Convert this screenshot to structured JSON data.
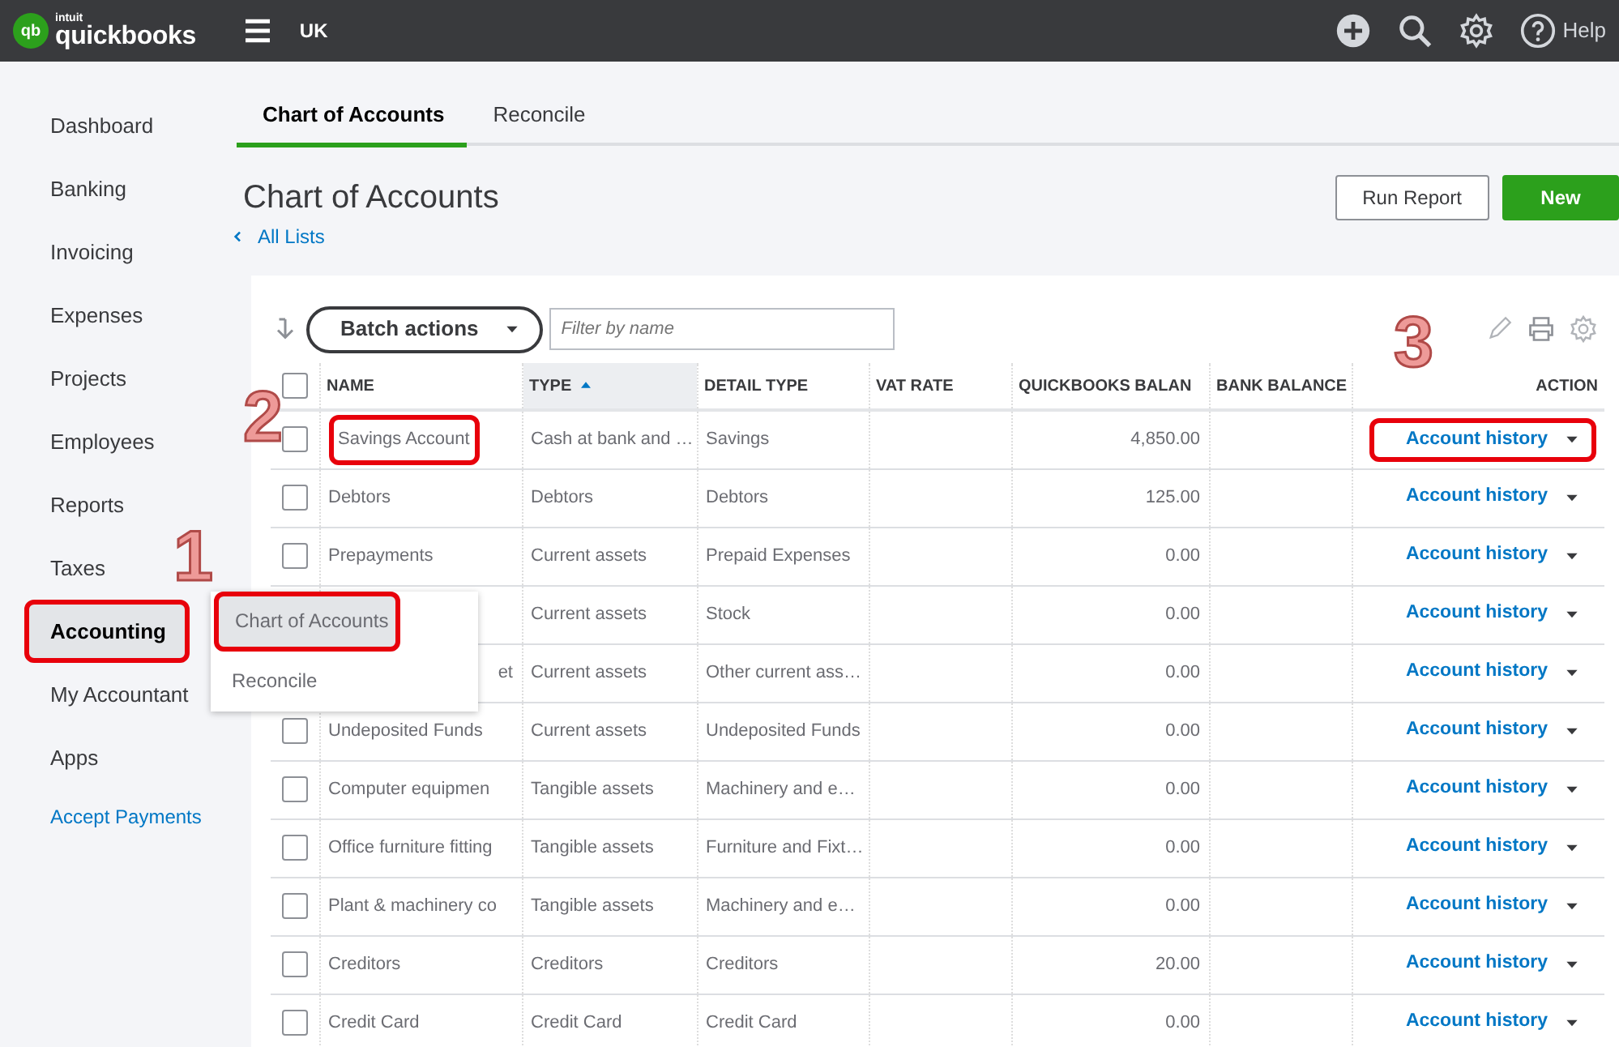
{
  "logo": {
    "mark": "qb",
    "brand": "intuit",
    "product": "quickbooks"
  },
  "topbar": {
    "region": "UK",
    "help": "Help"
  },
  "sidebar": {
    "items": [
      {
        "label": "Dashboard",
        "kind": "item",
        "selected": false,
        "highlighted": false
      },
      {
        "label": "Banking",
        "kind": "item",
        "selected": false,
        "highlighted": false
      },
      {
        "label": "Invoicing",
        "kind": "item",
        "selected": false,
        "highlighted": false
      },
      {
        "label": "Expenses",
        "kind": "item",
        "selected": false,
        "highlighted": false
      },
      {
        "label": "Projects",
        "kind": "item",
        "selected": false,
        "highlighted": false
      },
      {
        "label": "Employees",
        "kind": "item",
        "selected": false,
        "highlighted": false
      },
      {
        "label": "Reports",
        "kind": "item",
        "selected": false,
        "highlighted": false
      },
      {
        "label": "Taxes",
        "kind": "item",
        "selected": false,
        "highlighted": false
      },
      {
        "label": "Accounting",
        "kind": "item",
        "selected": true,
        "highlighted": true
      },
      {
        "label": "My Accountant",
        "kind": "item",
        "selected": false,
        "highlighted": false
      },
      {
        "label": "Apps",
        "kind": "item",
        "selected": false,
        "highlighted": false
      },
      {
        "label": "Accept Payments",
        "kind": "promo",
        "selected": false,
        "highlighted": false
      }
    ]
  },
  "tabs": [
    {
      "label": "Chart of Accounts",
      "selected": true
    },
    {
      "label": "Reconcile",
      "selected": false
    }
  ],
  "page": {
    "title": "Chart of Accounts",
    "back_link": "All Lists",
    "buttons": [
      {
        "label": "Run Report",
        "kind": "secondary"
      },
      {
        "label": "New",
        "kind": "primary"
      }
    ]
  },
  "toolbar": {
    "batch_button": "Batch actions",
    "filter_placeholder": "Filter by name"
  },
  "table": {
    "select_all_checked": false,
    "columns": [
      {
        "label": "NAME",
        "sorted": false
      },
      {
        "label": "TYPE",
        "sorted": true
      },
      {
        "label": "DETAIL TYPE",
        "sorted": false
      },
      {
        "label": "VAT RATE",
        "sorted": false
      },
      {
        "label": "QUICKBOOKS BALAN",
        "sorted": false
      },
      {
        "label": "BANK BALANCE",
        "sorted": false
      },
      {
        "label": "ACTION",
        "sorted": false
      }
    ],
    "rows": [
      {
        "checked": false,
        "name": "Savings Account",
        "type": "Cash at bank and …",
        "detail_type": "Savings",
        "balance": "4,850.00",
        "action": "Account history",
        "highlighted": true,
        "name_clipped_left": false
      },
      {
        "checked": false,
        "name": "Debtors",
        "type": "Debtors",
        "detail_type": "Debtors",
        "balance": "125.00",
        "action": "Account history",
        "highlighted": false,
        "name_clipped_left": false
      },
      {
        "checked": false,
        "name": "Prepayments",
        "type": "Current assets",
        "detail_type": "Prepaid Expenses",
        "balance": "0.00",
        "action": "Account history",
        "highlighted": false,
        "name_clipped_left": false
      },
      {
        "type": "Current assets",
        "detail_type": "Stock",
        "balance": "0.00",
        "action": "Account history",
        "highlighted": false
      },
      {
        "name": "et",
        "name_clipped_left": true,
        "type": "Current assets",
        "detail_type": "Other current ass…",
        "balance": "0.00",
        "action": "Account history",
        "highlighted": false
      },
      {
        "checked": false,
        "name": "Undeposited Funds",
        "type": "Current assets",
        "detail_type": "Undeposited Funds",
        "balance": "0.00",
        "action": "Account history",
        "highlighted": false,
        "name_clipped_left": false
      },
      {
        "checked": false,
        "name": "Computer equipmen",
        "type": "Tangible assets",
        "detail_type": "Machinery and e…",
        "balance": "0.00",
        "action": "Account history",
        "highlighted": false,
        "name_clipped_left": false
      },
      {
        "checked": false,
        "name": "Office furniture fitting",
        "type": "Tangible assets",
        "detail_type": "Furniture and Fixt…",
        "balance": "0.00",
        "action": "Account history",
        "highlighted": false,
        "name_clipped_left": false
      },
      {
        "checked": false,
        "name": "Plant & machinery co",
        "type": "Tangible assets",
        "detail_type": "Machinery and e…",
        "balance": "0.00",
        "action": "Account history",
        "highlighted": false,
        "name_clipped_left": false
      },
      {
        "checked": false,
        "name": "Creditors",
        "type": "Creditors",
        "detail_type": "Creditors",
        "balance": "20.00",
        "action": "Account history",
        "highlighted": false,
        "name_clipped_left": false
      },
      {
        "checked": false,
        "name": "Credit Card",
        "type": "Credit Card",
        "detail_type": "Credit Card",
        "balance": "0.00",
        "action": "Account history",
        "highlighted": false,
        "name_clipped_left": false
      }
    ]
  },
  "flyout": {
    "items": [
      {
        "label": "Chart of Accounts",
        "selected": true,
        "highlighted": true
      },
      {
        "label": "Reconcile",
        "selected": false,
        "highlighted": false
      }
    ]
  },
  "annotations": [
    {
      "label": "1"
    },
    {
      "label": "2"
    },
    {
      "label": "3"
    }
  ]
}
